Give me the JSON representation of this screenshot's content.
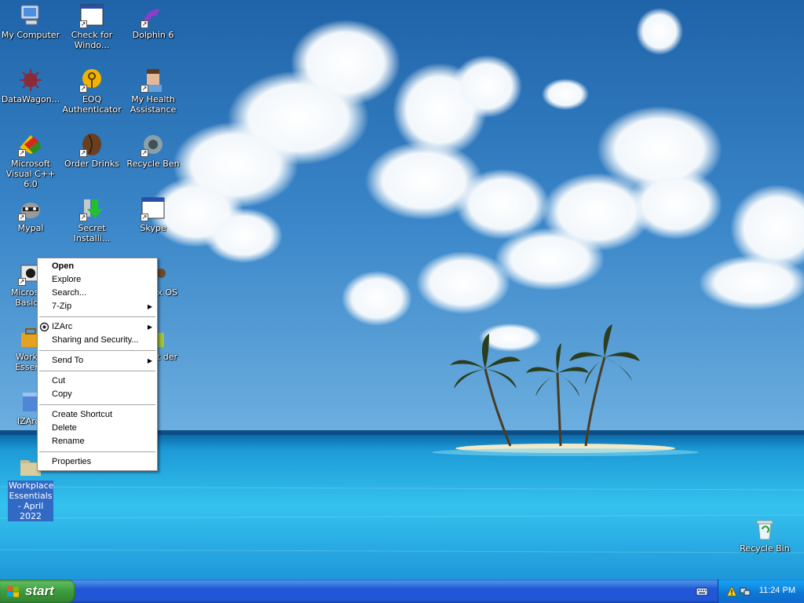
{
  "desktop": {
    "icons": [
      {
        "label": "My Computer"
      },
      {
        "label": "Check for Windo..."
      },
      {
        "label": "Dolphin 6"
      },
      {
        "label": "DataWagon..."
      },
      {
        "label": "EOQ Authenticator"
      },
      {
        "label": "My Health Assistance"
      },
      {
        "label": "Microsoft Visual C++ 6.0"
      },
      {
        "label": "Order Drinks"
      },
      {
        "label": "Recycle Ben"
      },
      {
        "label": "Mypal"
      },
      {
        "label": "Secret Installi..."
      },
      {
        "label": "Skype"
      },
      {
        "label": "Microsoft Basic 6"
      },
      {
        "label": "uix OS"
      },
      {
        "label": "Workpl Essenti"
      },
      {
        "label": "rit der"
      },
      {
        "label": "IZArc_"
      },
      {
        "label": "Workplace Essentials - April 2022"
      },
      {
        "label": "Recycle Bin"
      }
    ]
  },
  "context_menu": {
    "items": [
      "Open",
      "Explore",
      "Search...",
      "7-Zip",
      "IZArc",
      "Sharing and Security...",
      "Send To",
      "Cut",
      "Copy",
      "Create Shortcut",
      "Delete",
      "Rename",
      "Properties"
    ],
    "submenu_arrow": "▶"
  },
  "taskbar": {
    "start_label": "start",
    "clock": "11:24 PM"
  },
  "colors": {
    "selection": "#316ac5",
    "taskbar_blue": "#2157d7",
    "start_green": "#3d9c3d"
  },
  "icons_semantic": [
    "computer-icon",
    "window-icon",
    "dolphin-icon",
    "virus-icon",
    "key-icon",
    "doctor-icon",
    "vcpp-icon",
    "coffee-icon",
    "recycle-icon",
    "raccoon-icon",
    "download-icon",
    "skype-window-icon",
    "folder-icon",
    "recycle-bin-icon"
  ]
}
